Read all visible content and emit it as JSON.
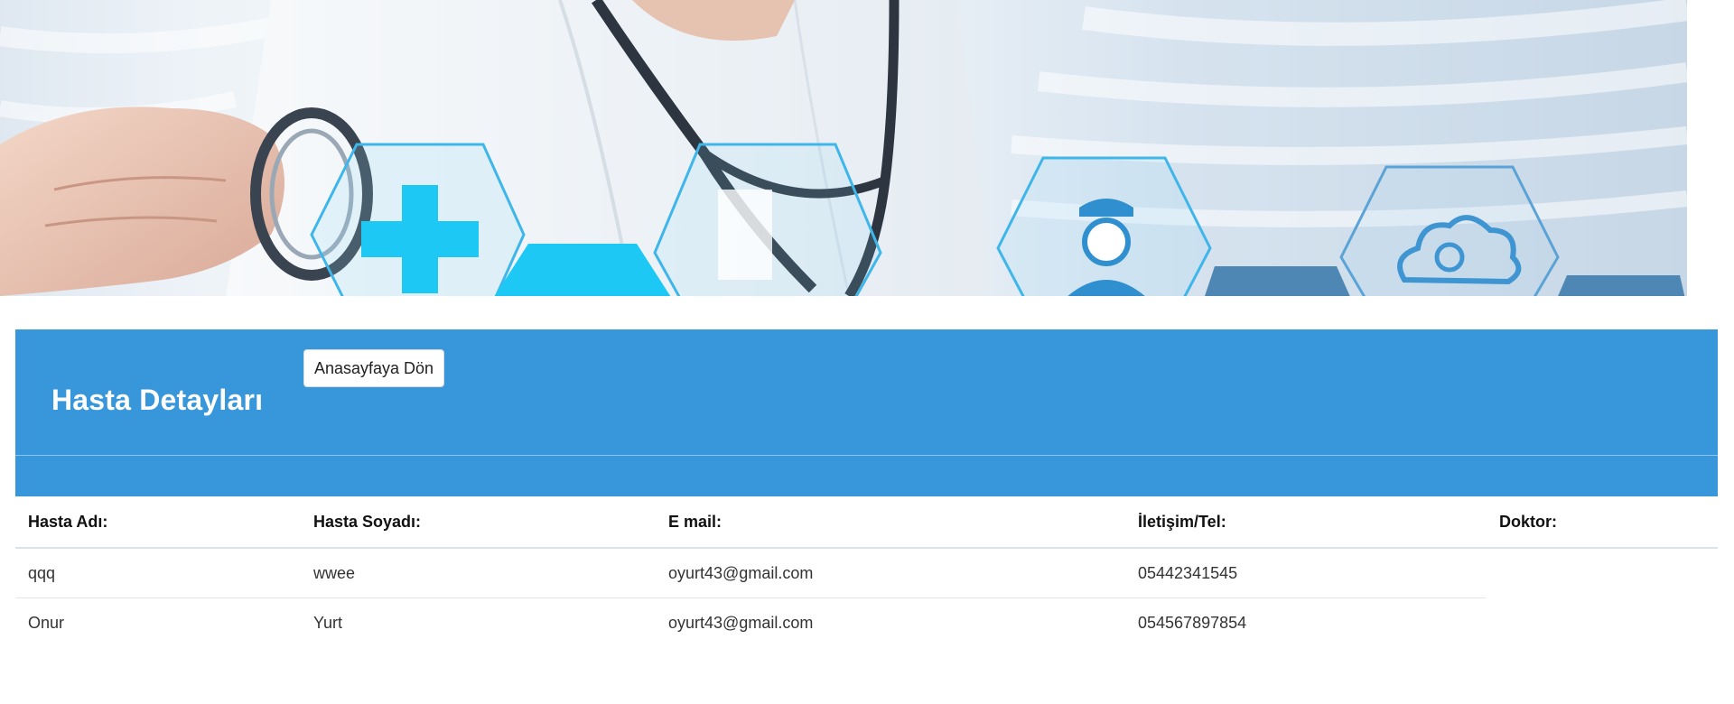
{
  "panel": {
    "title": "Hasta Detayları",
    "home_button_label": "Anasayfaya Dön"
  },
  "table": {
    "headers": [
      "Hasta Adı:",
      "Hasta Soyadı:",
      "E mail:",
      "İletişim/Tel:",
      "Doktor:"
    ],
    "rows": [
      [
        "qqq",
        "wwee",
        "oyurt43@gmail.com",
        "05442341545",
        ""
      ],
      [
        "Onur",
        "Yurt",
        "oyurt43@gmail.com",
        "054567897854",
        ""
      ]
    ]
  },
  "colors": {
    "panel_blue": "#3897db",
    "button_bg": "#ffffff",
    "hex_outline": "#3fb6ea",
    "hex_fill": "#1ec8f4"
  },
  "icons": [
    "cross-icon",
    "nurse-icon",
    "cloud-gear-icon",
    "stethoscope-icon"
  ]
}
